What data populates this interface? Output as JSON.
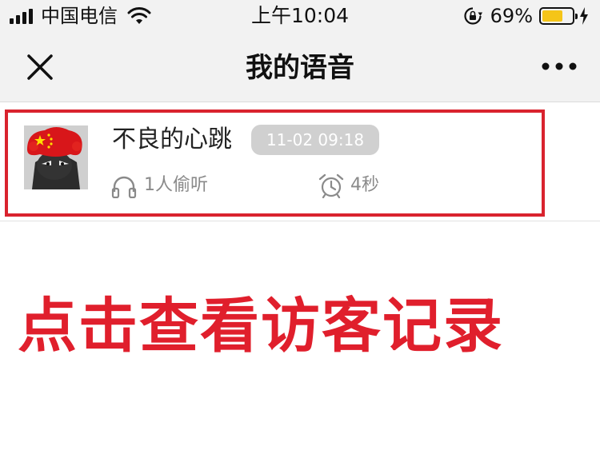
{
  "status_bar": {
    "carrier": "中国电信",
    "time": "上午10:04",
    "battery_percent": "69%",
    "battery_level": 0.69,
    "icons": [
      "signal-icon",
      "wifi-icon",
      "rotation-lock-icon",
      "battery-icon",
      "charging-icon"
    ]
  },
  "nav": {
    "title": "我的语音",
    "close_icon": "close-icon",
    "more_icon": "more-icon"
  },
  "voice_item": {
    "name": "不良的心跳",
    "date": "11-02 09:18",
    "listen_count": "1人偷听",
    "duration": "4秒",
    "icons": [
      "headphones-icon",
      "alarm-clock-icon"
    ]
  },
  "annotation": {
    "text": "点击查看访客记录",
    "color": "#e01f2c",
    "box_color": "#d9232e"
  }
}
